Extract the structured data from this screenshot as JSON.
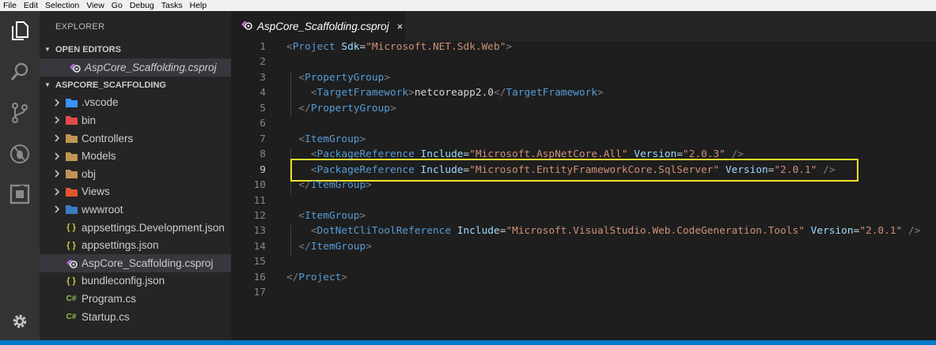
{
  "menu": [
    "File",
    "Edit",
    "Selection",
    "View",
    "Go",
    "Debug",
    "Tasks",
    "Help"
  ],
  "activity_bar": [
    "files-icon",
    "search-icon",
    "source-control-icon",
    "debug-icon",
    "extensions-icon",
    "settings-gear-icon"
  ],
  "sidebar": {
    "title": "EXPLORER",
    "open_editors": {
      "header": "OPEN EDITORS",
      "items": [
        {
          "label": "AspCore_Scaffolding.csproj",
          "icon": "csproj-icon"
        }
      ]
    },
    "project": {
      "header": "ASPCORE_SCAFFOLDING",
      "folders": [
        {
          "label": ".vscode",
          "icon": "vscode-folder-icon",
          "color": "#3794ff"
        },
        {
          "label": "bin",
          "icon": "bin-folder-icon",
          "color": "#e04b4b"
        },
        {
          "label": "Controllers",
          "icon": "folder-icon",
          "color": "#c09553"
        },
        {
          "label": "Models",
          "icon": "folder-icon",
          "color": "#c09553"
        },
        {
          "label": "obj",
          "icon": "folder-icon",
          "color": "#c09553"
        },
        {
          "label": "Views",
          "icon": "views-folder-icon",
          "color": "#e0552e"
        },
        {
          "label": "wwwroot",
          "icon": "wwwroot-folder-icon",
          "color": "#3c7bc4"
        }
      ],
      "files": [
        {
          "label": "appsettings.Development.json",
          "icon": "json-icon"
        },
        {
          "label": "appsettings.json",
          "icon": "json-icon"
        },
        {
          "label": "AspCore_Scaffolding.csproj",
          "icon": "csproj-icon"
        },
        {
          "label": "bundleconfig.json",
          "icon": "json-icon"
        },
        {
          "label": "Program.cs",
          "icon": "csharp-icon"
        },
        {
          "label": "Startup.cs",
          "icon": "csharp-icon"
        }
      ]
    }
  },
  "editor": {
    "tab": {
      "label": "AspCore_Scaffolding.csproj",
      "close": "×"
    },
    "highlighted_line": 9,
    "lines": [
      [
        [
          "tg",
          "<"
        ],
        [
          "tn",
          "Project"
        ],
        [
          "t",
          " "
        ],
        [
          "at",
          "Sdk"
        ],
        [
          "t",
          "="
        ],
        [
          "sv",
          "\"Microsoft.NET.Sdk.Web\""
        ],
        [
          "tg",
          ">"
        ]
      ],
      [],
      [
        [
          "t",
          "  "
        ],
        [
          "tg",
          "<"
        ],
        [
          "tn",
          "PropertyGroup"
        ],
        [
          "tg",
          ">"
        ]
      ],
      [
        [
          "t",
          "    "
        ],
        [
          "tg",
          "<"
        ],
        [
          "tn",
          "TargetFramework"
        ],
        [
          "tg",
          ">"
        ],
        [
          "t",
          "netcoreapp2.0"
        ],
        [
          "tg",
          "</"
        ],
        [
          "tn",
          "TargetFramework"
        ],
        [
          "tg",
          ">"
        ]
      ],
      [
        [
          "t",
          "  "
        ],
        [
          "tg",
          "</"
        ],
        [
          "tn",
          "PropertyGroup"
        ],
        [
          "tg",
          ">"
        ]
      ],
      [],
      [
        [
          "t",
          "  "
        ],
        [
          "tg",
          "<"
        ],
        [
          "tn",
          "ItemGroup"
        ],
        [
          "tg",
          ">"
        ]
      ],
      [
        [
          "t",
          "    "
        ],
        [
          "tg",
          "<"
        ],
        [
          "tn",
          "PackageReference"
        ],
        [
          "t",
          " "
        ],
        [
          "at",
          "Include"
        ],
        [
          "t",
          "="
        ],
        [
          "sv",
          "\"Microsoft.AspNetCore.All\""
        ],
        [
          "t",
          " "
        ],
        [
          "at",
          "Version"
        ],
        [
          "t",
          "="
        ],
        [
          "sv",
          "\"2.0.3\""
        ],
        [
          "t",
          " "
        ],
        [
          "tg",
          "/>"
        ]
      ],
      [
        [
          "t",
          "    "
        ],
        [
          "tg",
          "<"
        ],
        [
          "tn",
          "PackageReference"
        ],
        [
          "t",
          " "
        ],
        [
          "at",
          "Include"
        ],
        [
          "t",
          "="
        ],
        [
          "sv",
          "\"Microsoft.EntityFrameworkCore.SqlServer\""
        ],
        [
          "t",
          " "
        ],
        [
          "at",
          "Version"
        ],
        [
          "t",
          "="
        ],
        [
          "sv",
          "\"2.0.1\""
        ],
        [
          "t",
          " "
        ],
        [
          "tg",
          "/>"
        ]
      ],
      [
        [
          "t",
          "  "
        ],
        [
          "tg",
          "</"
        ],
        [
          "tn",
          "ItemGroup"
        ],
        [
          "tg",
          ">"
        ]
      ],
      [],
      [
        [
          "t",
          "  "
        ],
        [
          "tg",
          "<"
        ],
        [
          "tn",
          "ItemGroup"
        ],
        [
          "tg",
          ">"
        ]
      ],
      [
        [
          "t",
          "    "
        ],
        [
          "tg",
          "<"
        ],
        [
          "tn",
          "DotNetCliToolReference"
        ],
        [
          "t",
          " "
        ],
        [
          "at",
          "Include"
        ],
        [
          "t",
          "="
        ],
        [
          "sv",
          "\"Microsoft.VisualStudio.Web.CodeGeneration.Tools\""
        ],
        [
          "t",
          " "
        ],
        [
          "at",
          "Version"
        ],
        [
          "t",
          "="
        ],
        [
          "sv",
          "\"2.0.1\""
        ],
        [
          "t",
          " "
        ],
        [
          "tg",
          "/>"
        ]
      ],
      [
        [
          "t",
          "  "
        ],
        [
          "tg",
          "</"
        ],
        [
          "tn",
          "ItemGroup"
        ],
        [
          "tg",
          ">"
        ]
      ],
      [],
      [
        [
          "tg",
          "</"
        ],
        [
          "tn",
          "Project"
        ],
        [
          "tg",
          ">"
        ]
      ],
      []
    ]
  }
}
